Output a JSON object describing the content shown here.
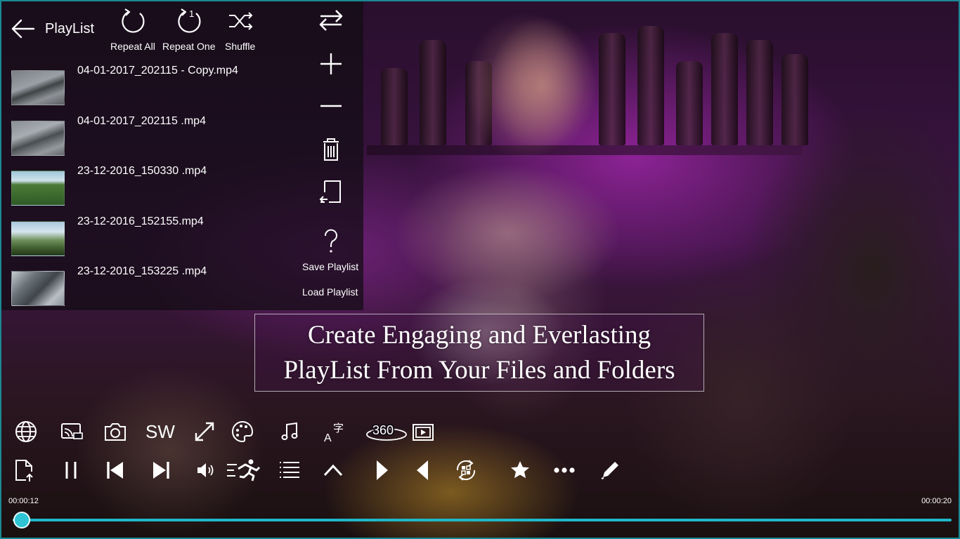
{
  "header": {
    "title": "PlayList",
    "modes": [
      {
        "label": "Repeat All",
        "icon": "repeat-all-icon"
      },
      {
        "label": "Repeat One",
        "icon": "repeat-one-icon",
        "badge": "1"
      },
      {
        "label": "Shuffle",
        "icon": "shuffle-icon"
      }
    ]
  },
  "playlist": {
    "items": [
      {
        "name": "04-01-2017_202115 - Copy.mp4"
      },
      {
        "name": "04-01-2017_202115 .mp4"
      },
      {
        "name": "23-12-2016_150330 .mp4"
      },
      {
        "name": "23-12-2016_152155.mp4"
      },
      {
        "name": "23-12-2016_153225 .mp4"
      }
    ]
  },
  "side_tools": {
    "icons": [
      "swap-icon",
      "add-icon",
      "remove-icon",
      "delete-icon",
      "export-icon",
      "help-icon"
    ],
    "save_label": "Save Playlist",
    "load_label": "Load Playlist"
  },
  "caption": {
    "line1": "Create Engaging and Everlasting",
    "line2": "PlayList From Your Files and Folders"
  },
  "toolbar_top": {
    "icons": [
      "globe-icon",
      "cast-icon",
      "camera-icon",
      "sw-text-icon",
      "fullscreen-icon",
      "palette-icon",
      "music-note-icon",
      "subtitle-icon",
      "360-view-icon",
      "picture-in-picture-icon"
    ],
    "sw_label": "SW",
    "label_360": "360"
  },
  "toolbar_bottom": {
    "icons": [
      "open-file-icon",
      "pause-icon",
      "previous-icon",
      "next-icon",
      "volume-icon",
      "speed-icon",
      "playlist-icon",
      "chevron-up-icon",
      "step-forward-icon",
      "step-back-icon",
      "repeat-ab-icon",
      "star-icon",
      "more-icon",
      "edit-icon"
    ]
  },
  "playback": {
    "current_time": "00:00:12",
    "total_time": "00:00:20",
    "progress": 0.01
  },
  "colors": {
    "accent": "#1fb7c8",
    "panel_bg": "#140c14"
  }
}
